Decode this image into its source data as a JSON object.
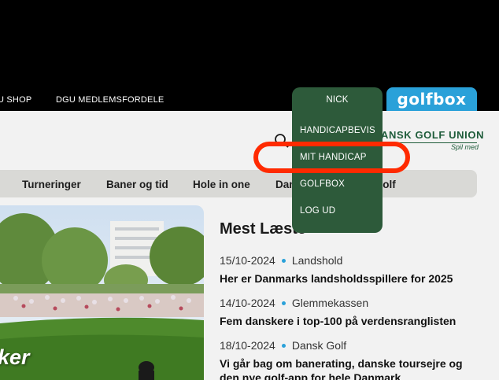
{
  "utility_nav": {
    "shop_label": "U SHOP",
    "benefits_label": "DGU MEDLEMSFORDELE",
    "golfbox_logo": "golfbox"
  },
  "dropdown": {
    "user_name": "NICK",
    "items": [
      "HANDICAPBEVIS",
      "MIT HANDICAP",
      "GOLFBOX",
      "LOG UD"
    ]
  },
  "brand": {
    "name": "ANSK GOLF UNION",
    "tagline": "Spil med"
  },
  "main_nav": {
    "items": [
      "Turneringer",
      "Baner og tid",
      "Hole in one",
      "Dan",
      "golf"
    ]
  },
  "hero": {
    "overlay_text": "ker"
  },
  "most_read": {
    "title": "Mest Læste",
    "articles": [
      {
        "date": "15/10-2024",
        "category": "Landshold",
        "title": "Her er Danmarks landsholdsspillere for 2025"
      },
      {
        "date": "14/10-2024",
        "category": "Glemmekassen",
        "title": "Fem danskere i top-100 på verdensranglisten"
      },
      {
        "date": "18/10-2024",
        "category": "Dansk Golf",
        "title": "Vi går bag om banerating, danske toursejre og den nye golf-app for hele Danmark"
      }
    ]
  },
  "colors": {
    "dropdown_bg": "#2d5a3a",
    "golfbox_blue": "#2aa1d9",
    "highlight": "#ff2a00",
    "brand_green": "#1e5c3a"
  }
}
